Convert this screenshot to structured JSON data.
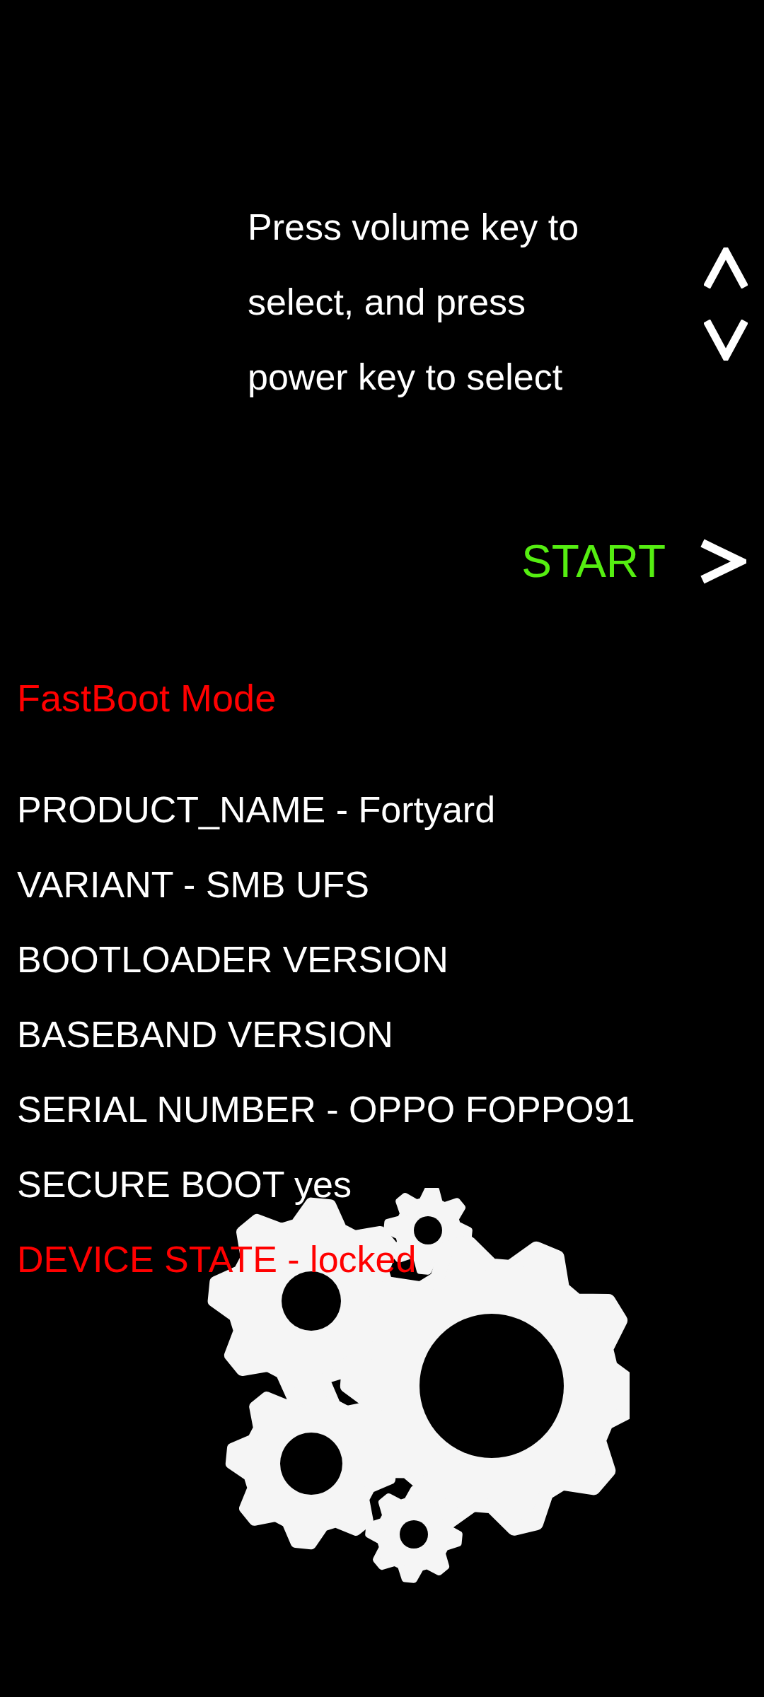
{
  "instructions": [
    "Press volume key to",
    "select, and press",
    "power key to select"
  ],
  "start": {
    "label": "START"
  },
  "mode_title": "FastBoot Mode",
  "info_lines": [
    {
      "text": "PRODUCT_NAME - Fortyard",
      "color": "#ffffff"
    },
    {
      "text": "VARIANT - SMB UFS",
      "color": "#ffffff"
    },
    {
      "text": "BOOTLOADER VERSION",
      "color": "#ffffff"
    },
    {
      "text": "BASEBAND VERSION",
      "color": "#ffffff"
    },
    {
      "text": "SERIAL NUMBER - OPPO FOPPO91",
      "color": "#ffffff"
    },
    {
      "text": "SECURE BOOT yes",
      "color": "#ffffff"
    },
    {
      "text": "DEVICE STATE - locked",
      "color": "#ff0000"
    }
  ]
}
